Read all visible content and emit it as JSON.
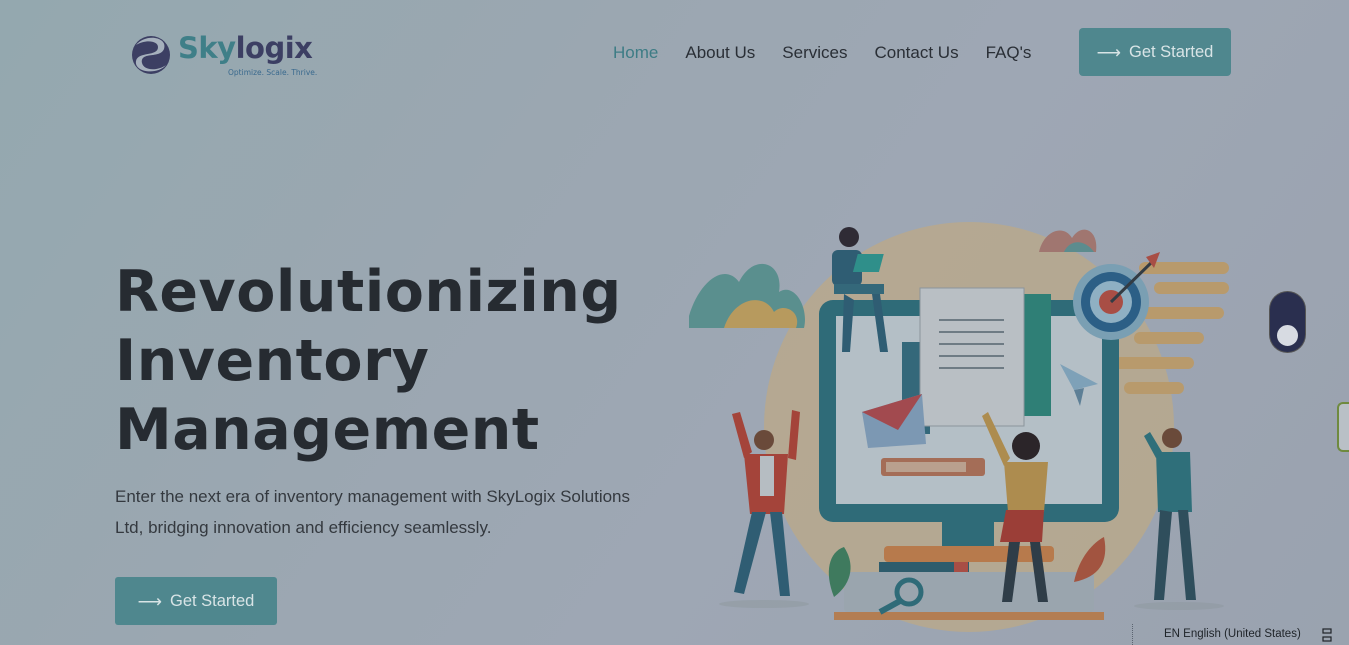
{
  "brand": {
    "name_part1": "Sky",
    "name_part2": "logix",
    "tagline": "Optimize. Scale. Thrive."
  },
  "nav": {
    "items": [
      {
        "label": "Home",
        "active": true
      },
      {
        "label": "About Us",
        "active": false
      },
      {
        "label": "Services",
        "active": false
      },
      {
        "label": "Contact Us",
        "active": false
      },
      {
        "label": "FAQ's",
        "active": false
      }
    ],
    "cta_label": "Get Started"
  },
  "hero": {
    "title_lines": [
      "Revolutionizing",
      "Inventory",
      "Management"
    ],
    "description": "Enter the next era of inventory management with SkyLogix Solutions Ltd, bridging innovation and efficiency seamlessly.",
    "cta_label": "Get Started"
  },
  "language_bar": {
    "label": "EN English (United States)"
  },
  "colors": {
    "accent": "#4f878e",
    "nav_active": "#3d7c85",
    "heading": "#262b31"
  }
}
